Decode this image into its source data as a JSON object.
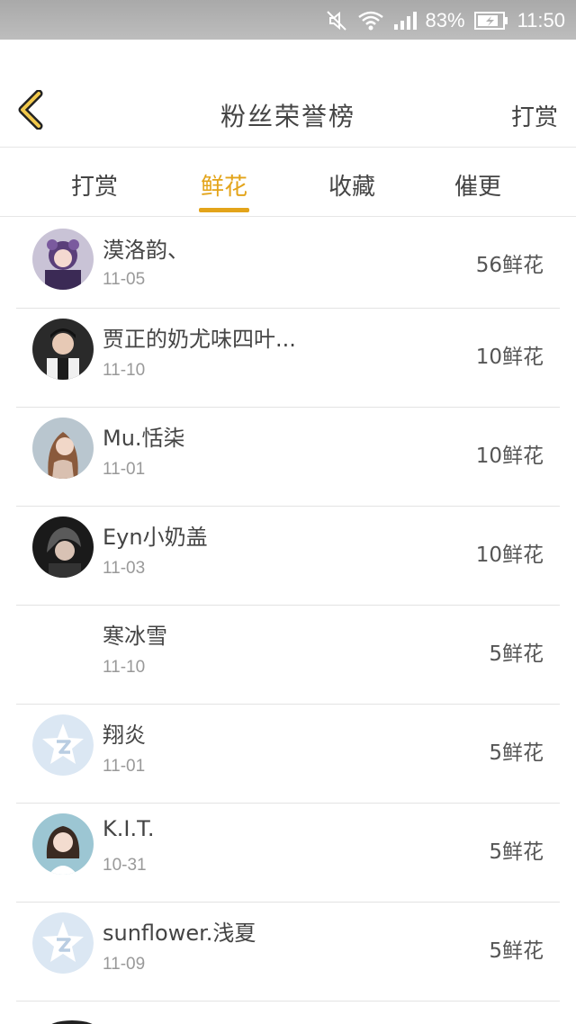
{
  "status_bar": {
    "battery": "83%",
    "time": "11:50"
  },
  "nav": {
    "title": "粉丝荣誉榜",
    "action": "打赏"
  },
  "tabs": [
    {
      "label": "打赏",
      "active": false
    },
    {
      "label": "鲜花",
      "active": true
    },
    {
      "label": "收藏",
      "active": false
    },
    {
      "label": "催更",
      "active": false
    }
  ],
  "accent_color": "#e3a41a",
  "rows": [
    {
      "name": "漠洛韵、",
      "date": "11-05",
      "count": "56鲜花",
      "avatar": "photo"
    },
    {
      "name": "贾正的奶尤味四叶...",
      "date": "11-10",
      "count": "10鲜花",
      "avatar": "photo"
    },
    {
      "name": "Mu.恬柒",
      "date": "11-01",
      "count": "10鲜花",
      "avatar": "photo"
    },
    {
      "name": "Eyn小奶盖",
      "date": "11-03",
      "count": "10鲜花",
      "avatar": "photo"
    },
    {
      "name": "寒冰雪",
      "date": "11-10",
      "count": "5鲜花",
      "avatar": "none"
    },
    {
      "name": "翔炎",
      "date": "11-01",
      "count": "5鲜花",
      "avatar": "default-qzone-icon"
    },
    {
      "name": "K.I.T.",
      "date": "10-31",
      "count": "5鲜花",
      "avatar": "photo"
    },
    {
      "name": "sunflower.浅夏",
      "date": "11-09",
      "count": "5鲜花",
      "avatar": "default-qzone-icon"
    }
  ]
}
